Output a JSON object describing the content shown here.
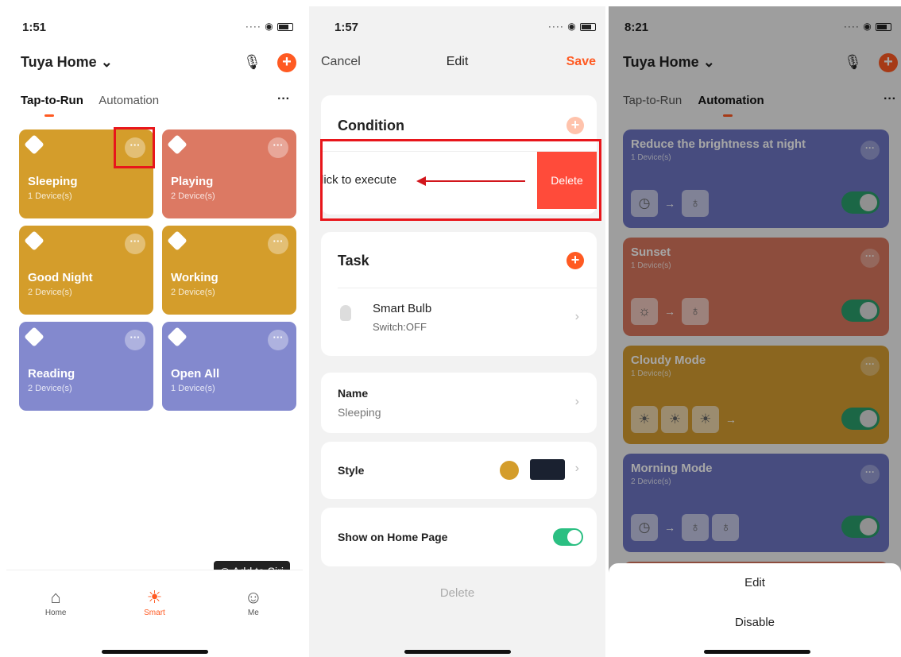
{
  "screen1": {
    "time": "1:51",
    "home_title": "Tuya Home ⌄",
    "tabs": [
      "Tap-to-Run",
      "Automation"
    ],
    "more": "···",
    "scenes": [
      {
        "name": "Sleeping",
        "sub": "1 Device(s)",
        "color": "#d49d2b"
      },
      {
        "name": "Playing",
        "sub": "2 Device(s)",
        "color": "#dc7963"
      },
      {
        "name": "Good Night",
        "sub": "2 Device(s)",
        "color": "#d49d2b"
      },
      {
        "name": "Working",
        "sub": "2 Device(s)",
        "color": "#d49d2b"
      },
      {
        "name": "Reading",
        "sub": "2 Device(s)",
        "color": "#8389ce"
      },
      {
        "name": "Open All",
        "sub": "1 Device(s)",
        "color": "#8389ce"
      }
    ],
    "siri": "Add to Siri",
    "nav": [
      "Home",
      "Smart",
      "Me"
    ]
  },
  "screen2": {
    "time": "1:57",
    "cancel": "Cancel",
    "title": "Edit",
    "save": "Save",
    "condition": "Condition",
    "condition_item": "lick to execute",
    "delete_swipe": "Delete",
    "task": "Task",
    "device_name": "Smart Bulb",
    "device_state": "Switch:OFF",
    "name_label": "Name",
    "name_value": "Sleeping",
    "style_label": "Style",
    "show_home": "Show on Home Page",
    "delete": "Delete"
  },
  "screen3": {
    "time": "8:21",
    "home_title": "Tuya Home ⌄",
    "tabs": [
      "Tap-to-Run",
      "Automation"
    ],
    "automations": [
      {
        "name": "Reduce the brightness at night",
        "sub": "1 Device(s)",
        "color": "#6e76c4"
      },
      {
        "name": "Sunset",
        "sub": "1 Device(s)",
        "color": "#d9775f"
      },
      {
        "name": "Cloudy Mode",
        "sub": "1 Device(s)",
        "color": "#d69d31"
      },
      {
        "name": "Morning Mode",
        "sub": "2 Device(s)",
        "color": "#6e76c4"
      }
    ],
    "sheet": [
      "Edit",
      "Disable"
    ]
  }
}
